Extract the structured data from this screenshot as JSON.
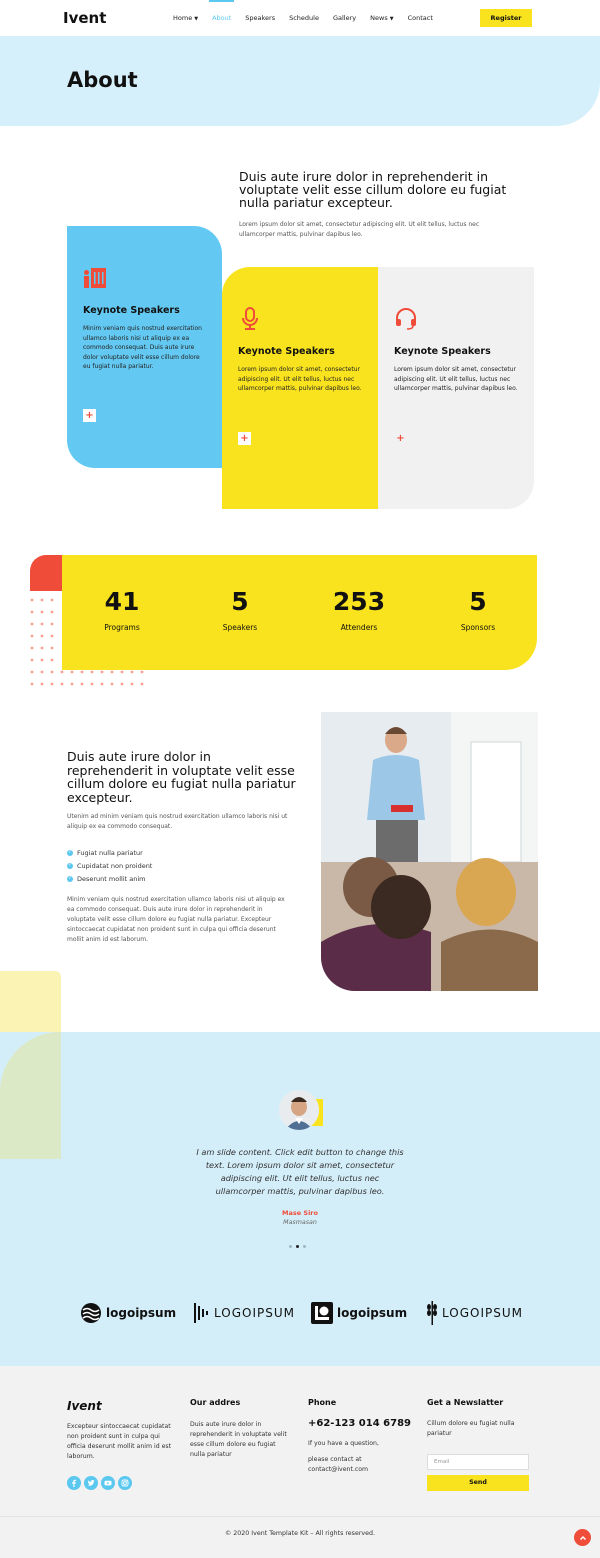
{
  "header": {
    "logo": "Ivent",
    "nav": [
      {
        "label": "Home",
        "has_dropdown": true
      },
      {
        "label": "About",
        "active": true
      },
      {
        "label": "Speakers"
      },
      {
        "label": "Schedule"
      },
      {
        "label": "Gallery"
      },
      {
        "label": "News",
        "has_dropdown": true
      },
      {
        "label": "Contact"
      }
    ],
    "register_label": "Register"
  },
  "hero": {
    "title": "About"
  },
  "intro": {
    "title": "Duis aute irure dolor in reprehenderit in voluptate velit esse cillum dolore eu fugiat nulla pariatur excepteur.",
    "text": "Lorem ipsum dolor sit amet, consectetur adipiscing elit. Ut elit tellus, luctus nec ullamcorper mattis, pulvinar dapibus leo."
  },
  "cards": [
    {
      "icon": "presentation-icon",
      "title": "Keynote Speakers",
      "text": "Minim veniam quis nostrud exercitation ullamco laboris nisi ut aliquip ex ea commodo consequat. Duis aute irure dolor voluptate velit esse cillum dolore eu fugiat nulla pariatur.",
      "button": "+"
    },
    {
      "icon": "microphone-icon",
      "title": "Keynote Speakers",
      "text": "Lorem ipsum dolor sit amet, consectetur adipiscing elit. Ut elit tellus, luctus nec ullamcorper mattis, pulvinar dapibus leo.",
      "button": "+"
    },
    {
      "icon": "headset-icon",
      "title": "Keynote Speakers",
      "text": "Lorem ipsum dolor sit amet, consectetur adipiscing elit. Ut elit tellus, luctus nec ullamcorper mattis, pulvinar dapibus leo.",
      "button": "+"
    }
  ],
  "stats": [
    {
      "value": "41",
      "label": "Programs"
    },
    {
      "value": "5",
      "label": "Speakers"
    },
    {
      "value": "253",
      "label": "Attenders"
    },
    {
      "value": "5",
      "label": "Sponsors"
    }
  ],
  "section2": {
    "title": "Duis aute irure dolor in reprehenderit in voluptate velit esse cillum dolore eu fugiat nulla pariatur excepteur.",
    "text": "Utenim ad minim veniam quis nostrud exercitation ullamco laboris nisi ut aliquip ex ea commodo consequat.",
    "checklist": [
      "Fugiat nulla pariatur",
      "Cupidatat non proident",
      "Deserunt mollit anim"
    ],
    "text2": "Minim veniam quis nostrud exercitation ullamco laboris nisi ut aliquip ex ea commodo consequat. Duis aute irure dolor in reprehenderit in voluptate velit esse cillum dolore eu fugiat nulla pariatur. Excepteur sintoccaecat cupidatat non proident sunt in culpa qui officia deserunt mollit anim id est laborum."
  },
  "testimonial": {
    "quote": "I am slide content. Click edit button to change this text. Lorem ipsum dolor sit amet, consectetur adipiscing elit. Ut elit tellus, luctus nec ullamcorper mattis, pulvinar dapibus leo.",
    "name": "Mase Siro",
    "role": "Masmasan"
  },
  "logos": [
    "logoipsum",
    "LOGOIPSUM",
    "logoipsum",
    "LOGOIPSUM"
  ],
  "footer": {
    "logo": "Ivent",
    "about": "Excepteur sintoccaecat cupidatat non proident sunt in culpa qui officia deserunt mollit anim id est laborum.",
    "address_title": "Our addres",
    "address": "Duis aute irure dolor in reprehenderit in voluptate velit esse cillum dolore eu fugiat nulla pariatur",
    "phone_title": "Phone",
    "phone": "+62-123 014 6789",
    "phone_note": "If you have a question,",
    "contact_note": "please contact at contact@ivent.com",
    "newsletter_title": "Get a Newslatter",
    "newsletter_text": "Cillum dolore eu fugiat nulla pariatur",
    "email_placeholder": "Email",
    "send_label": "Send",
    "copyright": "© 2020 Ivent Template Kit – All rights reserved."
  },
  "colors": {
    "accent_blue": "#5bc8ef",
    "accent_yellow": "#f8e31e",
    "accent_red": "#f04c3a"
  }
}
